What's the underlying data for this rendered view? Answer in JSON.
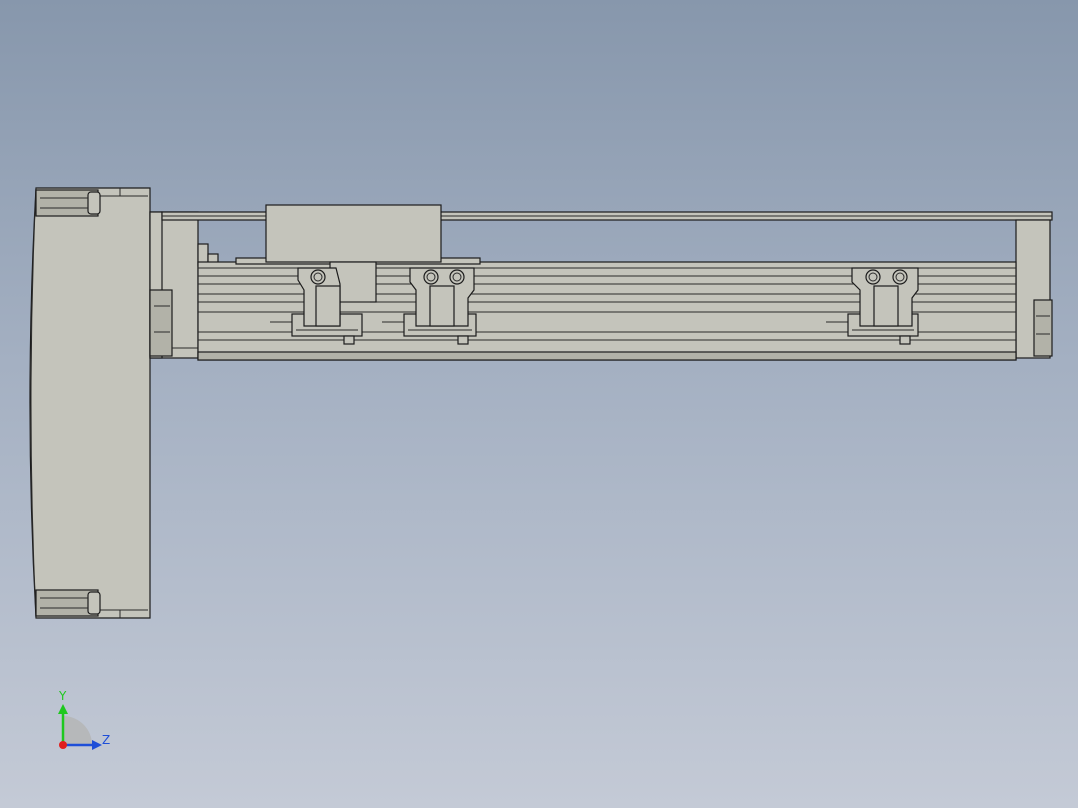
{
  "viewport": {
    "background_top": "#8797ac",
    "background_bottom": "#c4cad6",
    "model_fill": "#c4c4bb",
    "model_edge": "#1c1c1c"
  },
  "triad": {
    "y_label": "Y",
    "z_label": "Z",
    "y_color": "#1ec81e",
    "z_color": "#1e4ed8",
    "x_color": "#e01e1e"
  }
}
